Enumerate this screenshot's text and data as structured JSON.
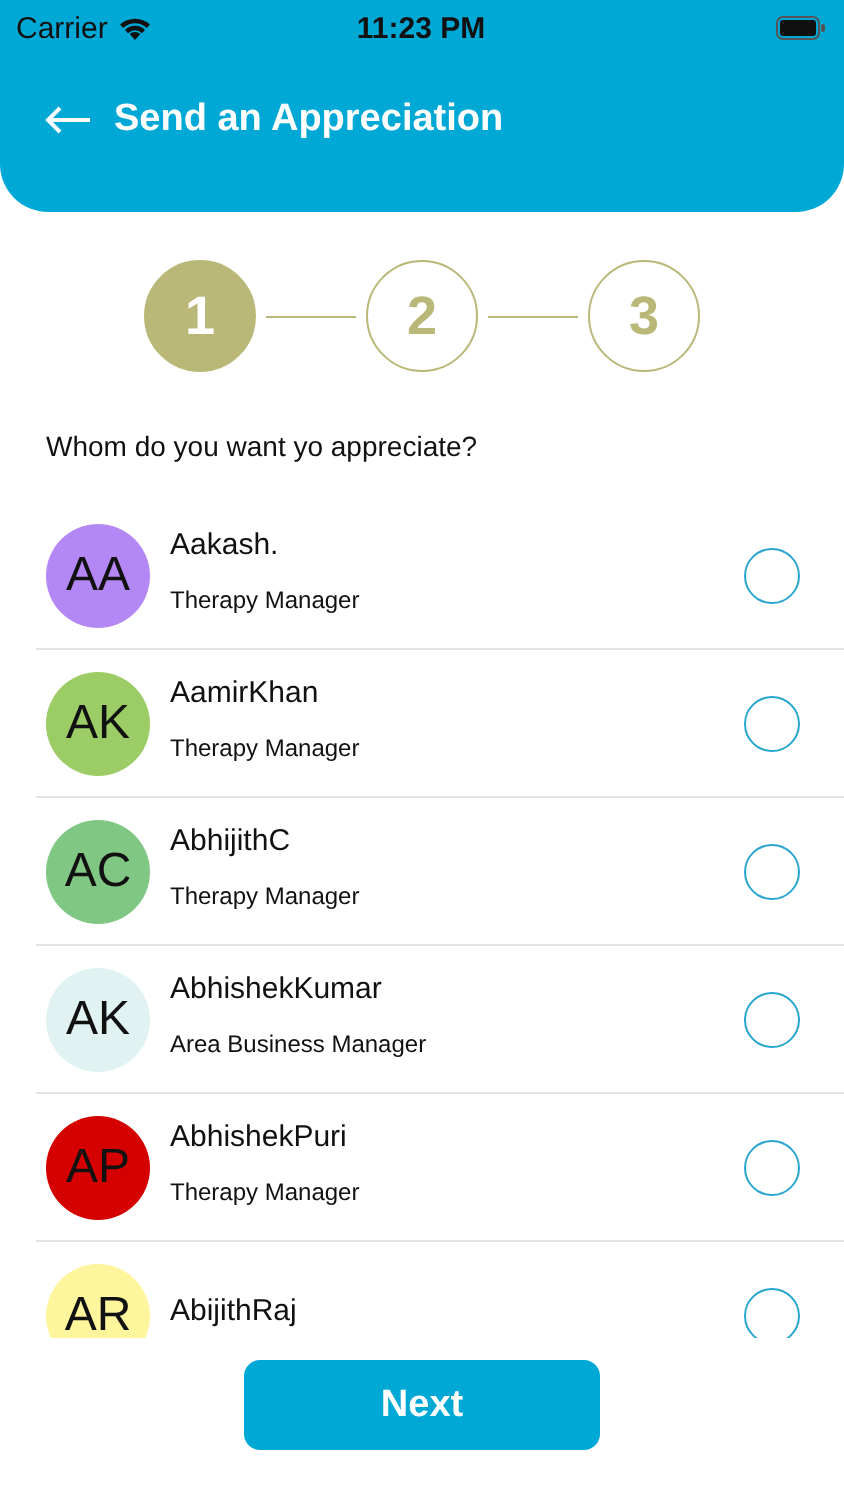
{
  "status_bar": {
    "carrier": "Carrier",
    "time": "11:23 PM"
  },
  "header": {
    "title": "Send an Appreciation"
  },
  "steps": [
    {
      "label": "1",
      "selected": true
    },
    {
      "label": "2",
      "selected": false
    },
    {
      "label": "3",
      "selected": false
    }
  ],
  "question": "Whom do you want yo appreciate?",
  "people": [
    {
      "initials": "AA",
      "name": "Aakash.",
      "role": "Therapy Manager",
      "color": "#b388f5",
      "selected": false
    },
    {
      "initials": "AK",
      "name": "AamirKhan",
      "role": "Therapy Manager",
      "color": "#9ccc65",
      "selected": false
    },
    {
      "initials": "AC",
      "name": "AbhijithC",
      "role": "Therapy Manager",
      "color": "#81c784",
      "selected": false
    },
    {
      "initials": "AK",
      "name": "AbhishekKumar",
      "role": "Area Business Manager",
      "color": "#e0f2f1",
      "selected": false
    },
    {
      "initials": "AP",
      "name": "AbhishekPuri",
      "role": "Therapy Manager",
      "color": "#d50000",
      "selected": false
    },
    {
      "initials": "AR",
      "name": "AbijithRaj",
      "color": "#fff59d",
      "selected": false
    }
  ],
  "next_button": "Next"
}
